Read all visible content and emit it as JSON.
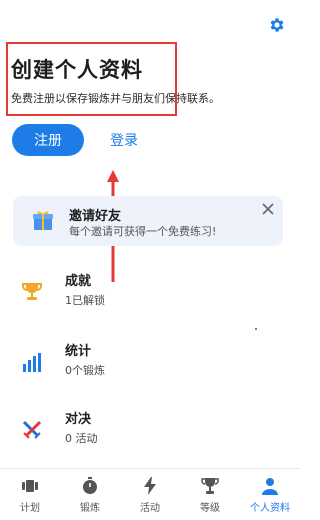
{
  "header": {
    "title": "创建个人资料",
    "subtitle": "免费注册以保存锻炼并与朋友们保持联系。"
  },
  "auth": {
    "register_label": "注册",
    "login_label": "登录"
  },
  "invite": {
    "title": "邀请好友",
    "description": "每个邀请可获得一个免费练习!"
  },
  "stats": [
    {
      "label": "成就",
      "value": "1已解锁",
      "icon": "trophy-icon"
    },
    {
      "label": "统计",
      "value": "0个锻炼",
      "icon": "bar-chart-icon"
    },
    {
      "label": "对决",
      "value": "0 活动",
      "icon": "crossed-swords-icon"
    }
  ],
  "nav": {
    "items": [
      {
        "label": "计划",
        "icon": "plan-icon"
      },
      {
        "label": "锻炼",
        "icon": "stopwatch-icon"
      },
      {
        "label": "活动",
        "icon": "lightning-icon"
      },
      {
        "label": "等级",
        "icon": "trophy-icon"
      },
      {
        "label": "个人资料",
        "icon": "person-icon"
      }
    ],
    "active": "个人资料"
  },
  "colors": {
    "accent": "#1e7ce8",
    "annotation_red": "#e53935",
    "card_bg": "#eef3fb",
    "trophy": "#f2a72b",
    "swords_blue": "#2a6bd6",
    "swords_red": "#e53935"
  }
}
